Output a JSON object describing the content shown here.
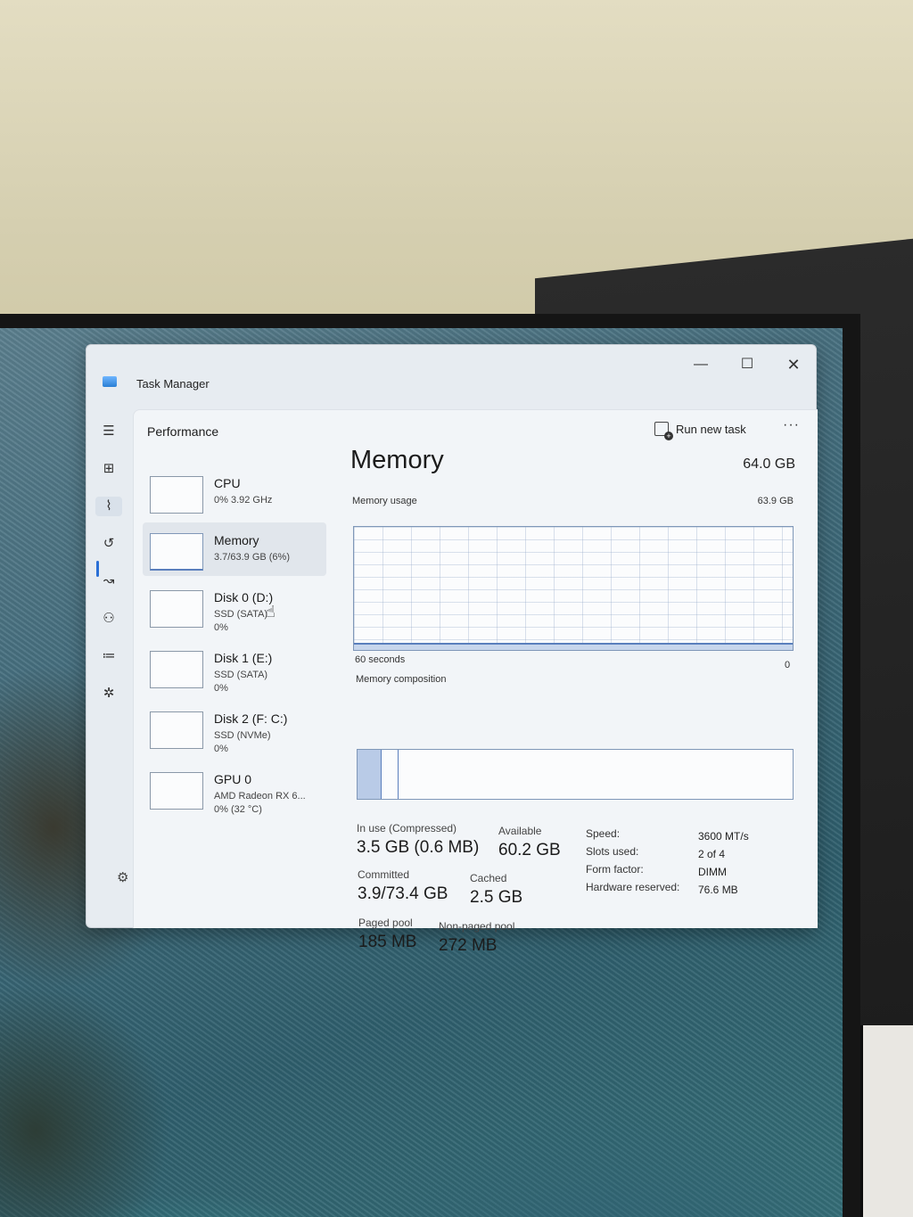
{
  "window": {
    "title": "Task Manager",
    "minimize_glyph": "—",
    "maximize_glyph": "☐",
    "close_glyph": "✕"
  },
  "nav": {
    "icons": [
      "hamburger-icon",
      "processes-icon",
      "performance-icon",
      "app-history-icon",
      "startup-apps-icon",
      "users-icon",
      "details-icon",
      "services-icon",
      "settings-icon"
    ]
  },
  "header": {
    "title": "Performance",
    "run_new_task": "Run new task",
    "more": "···"
  },
  "devices": [
    {
      "name": "CPU",
      "line1": "0% 3.92 GHz",
      "line2": ""
    },
    {
      "name": "Memory",
      "line1": "3.7/63.9 GB (6%)",
      "line2": ""
    },
    {
      "name": "Disk 0 (D:)",
      "line1": "SSD (SATA)",
      "line2": "0%"
    },
    {
      "name": "Disk 1 (E:)",
      "line1": "SSD (SATA)",
      "line2": "0%"
    },
    {
      "name": "Disk 2 (F: C:)",
      "line1": "SSD (NVMe)",
      "line2": "0%"
    },
    {
      "name": "GPU 0",
      "line1": "AMD Radeon RX 6...",
      "line2": "0% (32 °C)"
    }
  ],
  "memory": {
    "title": "Memory",
    "total": "64.0 GB",
    "usage_label": "Memory usage",
    "usage_max": "63.9 GB",
    "time_label": "60 seconds",
    "zero_label": "0",
    "composition_label": "Memory composition",
    "usage_fraction": 0.06,
    "in_use_fraction": 0.055,
    "cached_fraction": 0.039,
    "in_use_label": "In use (Compressed)",
    "in_use_value": "3.5 GB (0.6 MB)",
    "available_label": "Available",
    "available_value": "60.2 GB",
    "committed_label": "Committed",
    "committed_value": "3.9/73.4 GB",
    "cached_label": "Cached",
    "cached_value": "2.5 GB",
    "paged_pool_label": "Paged pool",
    "paged_pool_value": "185 MB",
    "non_paged_pool_label": "Non-paged pool",
    "non_paged_pool_value": "272 MB",
    "specs": [
      {
        "key": "Speed:",
        "value": "3600 MT/s"
      },
      {
        "key": "Slots used:",
        "value": "2 of 4"
      },
      {
        "key": "Form factor:",
        "value": "DIMM"
      },
      {
        "key": "Hardware reserved:",
        "value": "76.6 MB"
      }
    ]
  }
}
